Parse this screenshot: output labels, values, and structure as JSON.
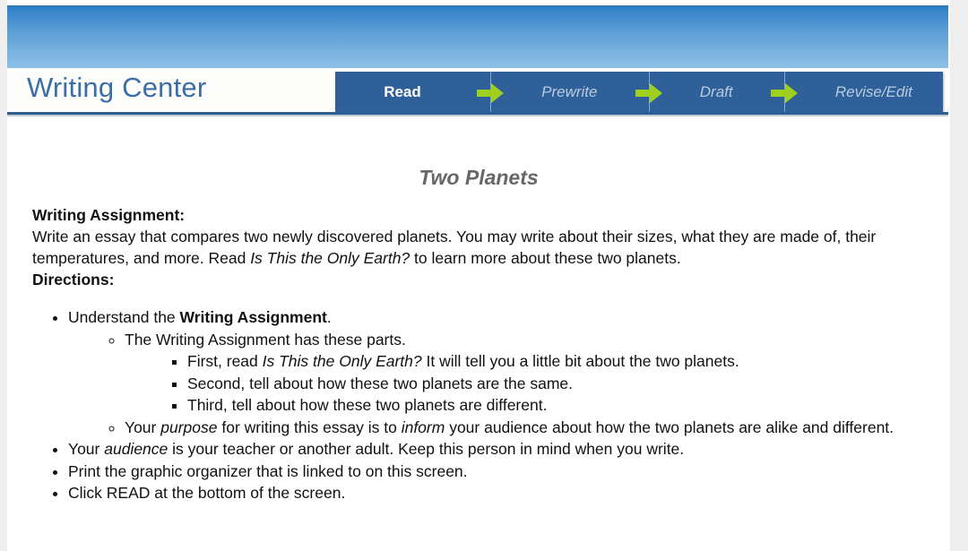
{
  "header": {
    "site_title": "Writing Center",
    "tabs": [
      {
        "label": "Read",
        "state": "active"
      },
      {
        "label": "Prewrite",
        "state": "inactive"
      },
      {
        "label": "Draft",
        "state": "inactive"
      },
      {
        "label": "Revise/Edit",
        "state": "inactive"
      }
    ],
    "separator_icon": "green-arrow-right-icon"
  },
  "colors": {
    "banner_top": "#2f7fc6",
    "banner_bottom": "#8cc0e6",
    "tabbar_blue": "#2f6099",
    "arrow_green": "#9fd01e",
    "title_blue": "#3a6ea5",
    "doc_title_gray": "#676767"
  },
  "document": {
    "title": "Two Planets",
    "assignment_heading": "Writing Assignment:",
    "assignment_body_part1": "Write an essay that compares two newly discovered planets. You may write about their sizes, what they are made of, their temperatures, and more. Read ",
    "assignment_body_italic": "Is This the Only Earth?",
    "assignment_body_part2": " to learn more about these two planets.",
    "directions_heading": "Directions:",
    "bullets": {
      "b1_pre": "Understand the ",
      "b1_bold": "Writing Assignment",
      "b1_post": ".",
      "b1_sub1": "The Writing Assignment has these parts.",
      "b1_sub1_item1_pre": "First, read ",
      "b1_sub1_item1_italic": "Is This the Only Earth?",
      "b1_sub1_item1_post": " It will tell you a little bit about the two planets.",
      "b1_sub1_item2": "Second, tell about how these two planets are the same.",
      "b1_sub1_item3": "Third, tell about how these two planets are different.",
      "b1_sub2_pre": "Your ",
      "b1_sub2_italic1": "purpose",
      "b1_sub2_mid": " for writing this essay is to ",
      "b1_sub2_italic2": "inform",
      "b1_sub2_post": " your audience about how the two planets are alike and different.",
      "b2_pre": "Your ",
      "b2_italic": "audience",
      "b2_post": " is your teacher or another adult. Keep this person in mind when you write.",
      "b3": "Print the graphic organizer that is linked to on this screen.",
      "b4": "Click READ at the bottom of the screen."
    }
  }
}
